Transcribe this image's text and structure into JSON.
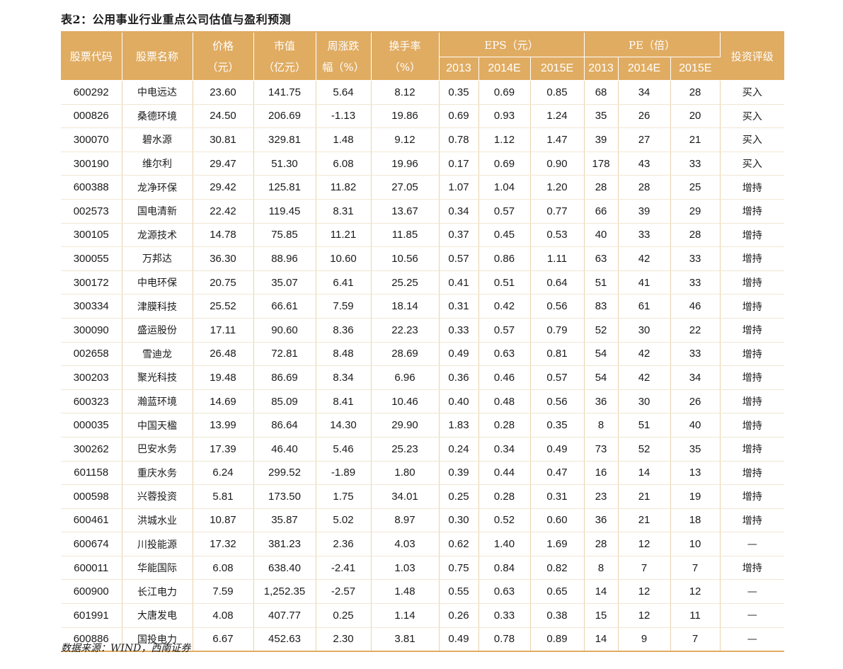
{
  "title": "表2：公用事业行业重点公司估值与盈利预测",
  "source": "数据来源：WIND，西南证券",
  "header": {
    "code": "股票代码",
    "name": "股票名称",
    "price_top": "价格",
    "price_bottom": "（元）",
    "mcap_top": "市值",
    "mcap_bottom": "（亿元）",
    "weekly_top": "周涨跌",
    "weekly_bottom": "幅（%）",
    "turnover_top": "换手率",
    "turnover_bottom": "（%）",
    "eps": "EPS（元）",
    "pe": "PE（倍）",
    "rating": "投资评级",
    "eps_years": [
      "2013",
      "2014E",
      "2015E"
    ],
    "pe_years": [
      "2013",
      "2014E",
      "2015E"
    ]
  },
  "rows": [
    {
      "code": "600292",
      "name": "中电远达",
      "price": "23.60",
      "mcap": "141.75",
      "weekly": "5.64",
      "turnover": "8.12",
      "eps13": "0.35",
      "eps14": "0.69",
      "eps15": "0.85",
      "pe13": "68",
      "pe14": "34",
      "pe15": "28",
      "rating": "买入"
    },
    {
      "code": "000826",
      "name": "桑德环境",
      "price": "24.50",
      "mcap": "206.69",
      "weekly": "-1.13",
      "turnover": "19.86",
      "eps13": "0.69",
      "eps14": "0.93",
      "eps15": "1.24",
      "pe13": "35",
      "pe14": "26",
      "pe15": "20",
      "rating": "买入"
    },
    {
      "code": "300070",
      "name": "碧水源",
      "price": "30.81",
      "mcap": "329.81",
      "weekly": "1.48",
      "turnover": "9.12",
      "eps13": "0.78",
      "eps14": "1.12",
      "eps15": "1.47",
      "pe13": "39",
      "pe14": "27",
      "pe15": "21",
      "rating": "买入"
    },
    {
      "code": "300190",
      "name": "维尔利",
      "price": "29.47",
      "mcap": "51.30",
      "weekly": "6.08",
      "turnover": "19.96",
      "eps13": "0.17",
      "eps14": "0.69",
      "eps15": "0.90",
      "pe13": "178",
      "pe14": "43",
      "pe15": "33",
      "rating": "买入"
    },
    {
      "code": "600388",
      "name": "龙净环保",
      "price": "29.42",
      "mcap": "125.81",
      "weekly": "11.82",
      "turnover": "27.05",
      "eps13": "1.07",
      "eps14": "1.04",
      "eps15": "1.20",
      "pe13": "28",
      "pe14": "28",
      "pe15": "25",
      "rating": "增持"
    },
    {
      "code": "002573",
      "name": "国电清新",
      "price": "22.42",
      "mcap": "119.45",
      "weekly": "8.31",
      "turnover": "13.67",
      "eps13": "0.34",
      "eps14": "0.57",
      "eps15": "0.77",
      "pe13": "66",
      "pe14": "39",
      "pe15": "29",
      "rating": "增持"
    },
    {
      "code": "300105",
      "name": "龙源技术",
      "price": "14.78",
      "mcap": "75.85",
      "weekly": "11.21",
      "turnover": "11.85",
      "eps13": "0.37",
      "eps14": "0.45",
      "eps15": "0.53",
      "pe13": "40",
      "pe14": "33",
      "pe15": "28",
      "rating": "增持"
    },
    {
      "code": "300055",
      "name": "万邦达",
      "price": "36.30",
      "mcap": "88.96",
      "weekly": "10.60",
      "turnover": "10.56",
      "eps13": "0.57",
      "eps14": "0.86",
      "eps15": "1.11",
      "pe13": "63",
      "pe14": "42",
      "pe15": "33",
      "rating": "增持"
    },
    {
      "code": "300172",
      "name": "中电环保",
      "price": "20.75",
      "mcap": "35.07",
      "weekly": "6.41",
      "turnover": "25.25",
      "eps13": "0.41",
      "eps14": "0.51",
      "eps15": "0.64",
      "pe13": "51",
      "pe14": "41",
      "pe15": "33",
      "rating": "增持"
    },
    {
      "code": "300334",
      "name": "津膜科技",
      "price": "25.52",
      "mcap": "66.61",
      "weekly": "7.59",
      "turnover": "18.14",
      "eps13": "0.31",
      "eps14": "0.42",
      "eps15": "0.56",
      "pe13": "83",
      "pe14": "61",
      "pe15": "46",
      "rating": "增持"
    },
    {
      "code": "300090",
      "name": "盛运股份",
      "price": "17.11",
      "mcap": "90.60",
      "weekly": "8.36",
      "turnover": "22.23",
      "eps13": "0.33",
      "eps14": "0.57",
      "eps15": "0.79",
      "pe13": "52",
      "pe14": "30",
      "pe15": "22",
      "rating": "增持"
    },
    {
      "code": "002658",
      "name": "雪迪龙",
      "price": "26.48",
      "mcap": "72.81",
      "weekly": "8.48",
      "turnover": "28.69",
      "eps13": "0.49",
      "eps14": "0.63",
      "eps15": "0.81",
      "pe13": "54",
      "pe14": "42",
      "pe15": "33",
      "rating": "增持"
    },
    {
      "code": "300203",
      "name": "聚光科技",
      "price": "19.48",
      "mcap": "86.69",
      "weekly": "8.34",
      "turnover": "6.96",
      "eps13": "0.36",
      "eps14": "0.46",
      "eps15": "0.57",
      "pe13": "54",
      "pe14": "42",
      "pe15": "34",
      "rating": "增持"
    },
    {
      "code": "600323",
      "name": "瀚蓝环境",
      "price": "14.69",
      "mcap": "85.09",
      "weekly": "8.41",
      "turnover": "10.46",
      "eps13": "0.40",
      "eps14": "0.48",
      "eps15": "0.56",
      "pe13": "36",
      "pe14": "30",
      "pe15": "26",
      "rating": "增持"
    },
    {
      "code": "000035",
      "name": "中国天楹",
      "price": "13.99",
      "mcap": "86.64",
      "weekly": "14.30",
      "turnover": "29.90",
      "eps13": "1.83",
      "eps14": "0.28",
      "eps15": "0.35",
      "pe13": "8",
      "pe14": "51",
      "pe15": "40",
      "rating": "增持"
    },
    {
      "code": "300262",
      "name": "巴安水务",
      "price": "17.39",
      "mcap": "46.40",
      "weekly": "5.46",
      "turnover": "25.23",
      "eps13": "0.24",
      "eps14": "0.34",
      "eps15": "0.49",
      "pe13": "73",
      "pe14": "52",
      "pe15": "35",
      "rating": "增持"
    },
    {
      "code": "601158",
      "name": "重庆水务",
      "price": "6.24",
      "mcap": "299.52",
      "weekly": "-1.89",
      "turnover": "1.80",
      "eps13": "0.39",
      "eps14": "0.44",
      "eps15": "0.47",
      "pe13": "16",
      "pe14": "14",
      "pe15": "13",
      "rating": "增持"
    },
    {
      "code": "000598",
      "name": "兴蓉投资",
      "price": "5.81",
      "mcap": "173.50",
      "weekly": "1.75",
      "turnover": "34.01",
      "eps13": "0.25",
      "eps14": "0.28",
      "eps15": "0.31",
      "pe13": "23",
      "pe14": "21",
      "pe15": "19",
      "rating": "增持"
    },
    {
      "code": "600461",
      "name": "洪城水业",
      "price": "10.87",
      "mcap": "35.87",
      "weekly": "5.02",
      "turnover": "8.97",
      "eps13": "0.30",
      "eps14": "0.52",
      "eps15": "0.60",
      "pe13": "36",
      "pe14": "21",
      "pe15": "18",
      "rating": "增持"
    },
    {
      "code": "600674",
      "name": "川投能源",
      "price": "17.32",
      "mcap": "381.23",
      "weekly": "2.36",
      "turnover": "4.03",
      "eps13": "0.62",
      "eps14": "1.40",
      "eps15": "1.69",
      "pe13": "28",
      "pe14": "12",
      "pe15": "10",
      "rating": "—"
    },
    {
      "code": "600011",
      "name": "华能国际",
      "price": "6.08",
      "mcap": "638.40",
      "weekly": "-2.41",
      "turnover": "1.03",
      "eps13": "0.75",
      "eps14": "0.84",
      "eps15": "0.82",
      "pe13": "8",
      "pe14": "7",
      "pe15": "7",
      "rating": "增持"
    },
    {
      "code": "600900",
      "name": "长江电力",
      "price": "7.59",
      "mcap": "1,252.35",
      "weekly": "-2.57",
      "turnover": "1.48",
      "eps13": "0.55",
      "eps14": "0.63",
      "eps15": "0.65",
      "pe13": "14",
      "pe14": "12",
      "pe15": "12",
      "rating": "—"
    },
    {
      "code": "601991",
      "name": "大唐发电",
      "price": "4.08",
      "mcap": "407.77",
      "weekly": "0.25",
      "turnover": "1.14",
      "eps13": "0.26",
      "eps14": "0.33",
      "eps15": "0.38",
      "pe13": "15",
      "pe14": "12",
      "pe15": "11",
      "rating": "—"
    },
    {
      "code": "600886",
      "name": "国投电力",
      "price": "6.67",
      "mcap": "452.63",
      "weekly": "2.30",
      "turnover": "3.81",
      "eps13": "0.49",
      "eps14": "0.78",
      "eps15": "0.89",
      "pe13": "14",
      "pe14": "9",
      "pe15": "7",
      "rating": "—"
    }
  ]
}
